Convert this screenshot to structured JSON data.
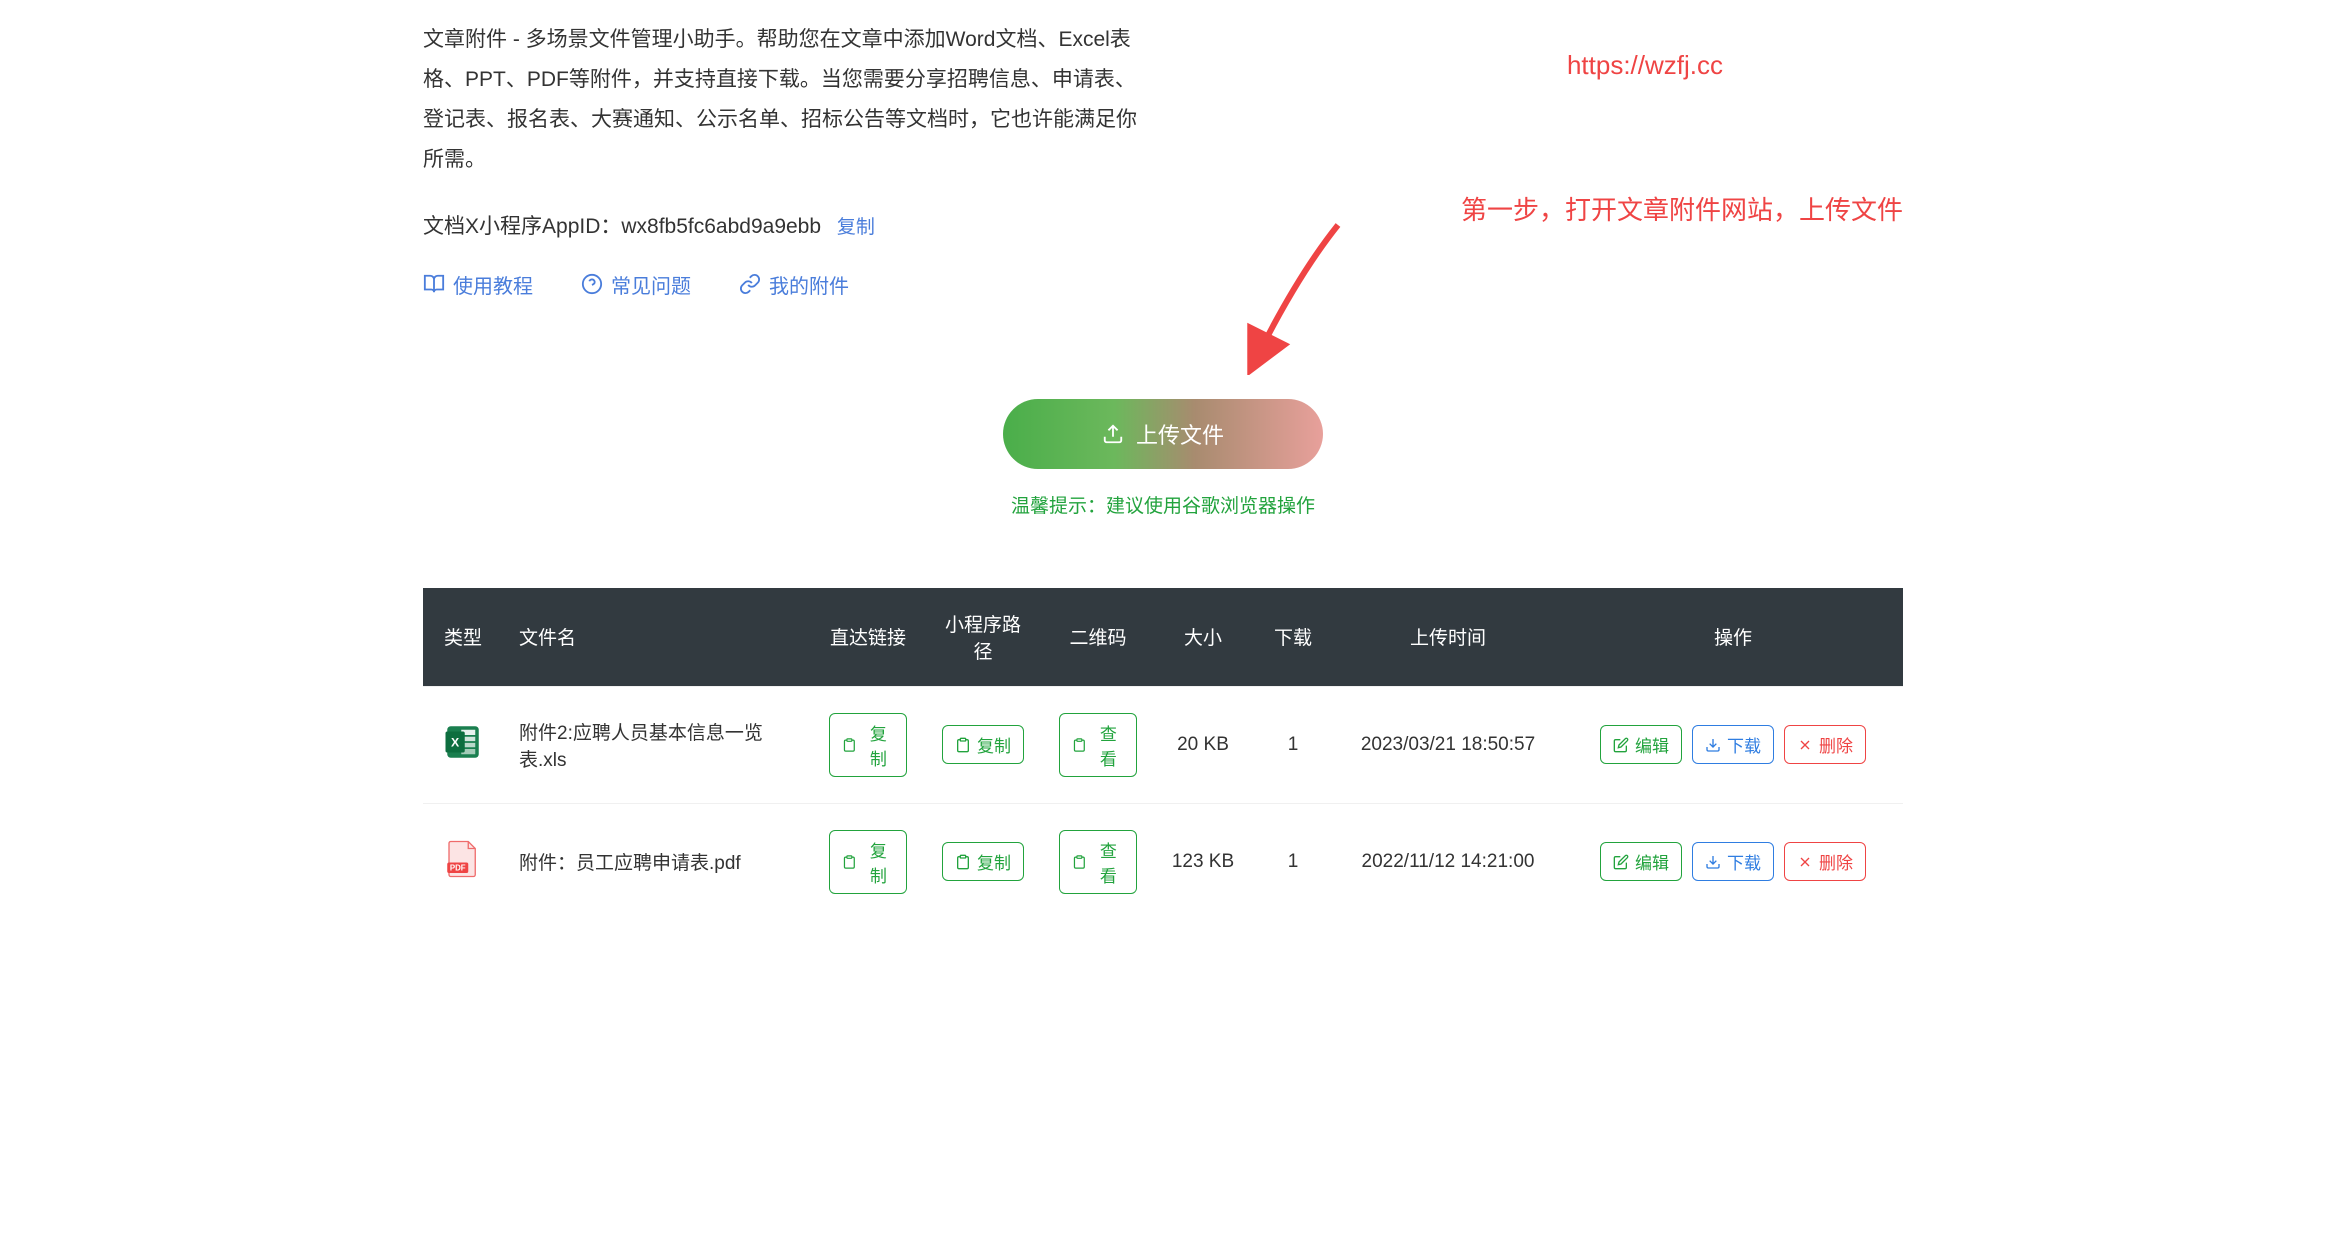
{
  "description": "文章附件 - 多场景文件管理小助手。帮助您在文章中添加Word文档、Excel表格、PPT、PDF等附件，并支持直接下载。当您需要分享招聘信息、申请表、登记表、报名表、大赛通知、公示名单、招标公告等文档时，它也许能满足你所需。",
  "appid_label": "文档X小程序AppID：",
  "appid_value": "wx8fb5fc6abd9a9ebb",
  "copy_label": "复制",
  "nav": {
    "tutorial": "使用教程",
    "faq": "常见问题",
    "my_files": "我的附件"
  },
  "annotation": {
    "url": "https://wzfj.cc",
    "step1": "第一步，打开文章附件网站，上传文件"
  },
  "upload": {
    "button_label": "上传文件",
    "hint": "温馨提示：建议使用谷歌浏览器操作"
  },
  "table": {
    "headers": {
      "type": "类型",
      "filename": "文件名",
      "direct_link": "直达链接",
      "miniapp_path": "小程序路径",
      "qrcode": "二维码",
      "size": "大小",
      "download": "下载",
      "upload_time": "上传时间",
      "action": "操作"
    },
    "buttons": {
      "copy": "复制",
      "view": "查看",
      "edit": "编辑",
      "download": "下载",
      "delete": "删除"
    },
    "rows": [
      {
        "icon_type": "xls",
        "filename": "附件2:应聘人员基本信息一览表.xls",
        "size": "20 KB",
        "download_count": "1",
        "upload_time": "2023/03/21 18:50:57"
      },
      {
        "icon_type": "pdf",
        "filename": "附件：员工应聘申请表.pdf",
        "size": "123 KB",
        "download_count": "1",
        "upload_time": "2022/11/12 14:21:00"
      }
    ]
  }
}
